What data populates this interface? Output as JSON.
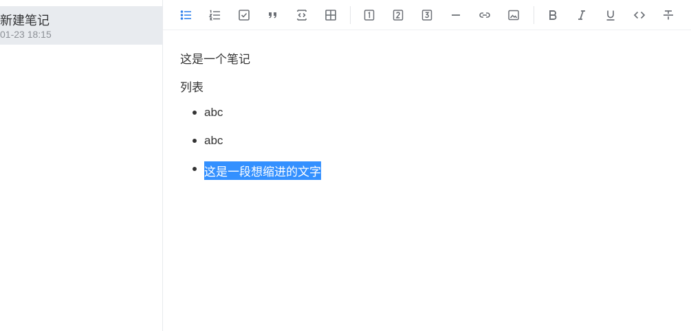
{
  "sidebar": {
    "note": {
      "title": "新建笔记",
      "time": "01-23 18:15"
    }
  },
  "toolbar": {
    "buttons": [
      {
        "icon": "bullet-list-icon",
        "active": true
      },
      {
        "icon": "ordered-list-icon"
      },
      {
        "icon": "checkbox-icon"
      },
      {
        "icon": "quote-icon"
      },
      {
        "icon": "code-block-icon"
      },
      {
        "icon": "table-icon"
      },
      {
        "icon": "heading-1-icon",
        "label": "1"
      },
      {
        "icon": "heading-2-icon",
        "label": "2"
      },
      {
        "icon": "heading-3-icon",
        "label": "3"
      },
      {
        "icon": "horizontal-rule-icon"
      },
      {
        "icon": "link-icon"
      },
      {
        "icon": "image-icon"
      },
      {
        "icon": "bold-icon",
        "label": "B"
      },
      {
        "icon": "italic-icon",
        "label": "I"
      },
      {
        "icon": "underline-icon",
        "label": "U"
      },
      {
        "icon": "inline-code-icon"
      },
      {
        "icon": "strikethrough-icon"
      }
    ],
    "active_color": "#2f80ed",
    "icon_color": "#6b6f75"
  },
  "content": {
    "paragraph_1": "这是一个笔记",
    "paragraph_2": "列表",
    "list_items": [
      "abc",
      "abc",
      "这是一段想缩进的文字"
    ],
    "selection_color": "#3390ff"
  }
}
